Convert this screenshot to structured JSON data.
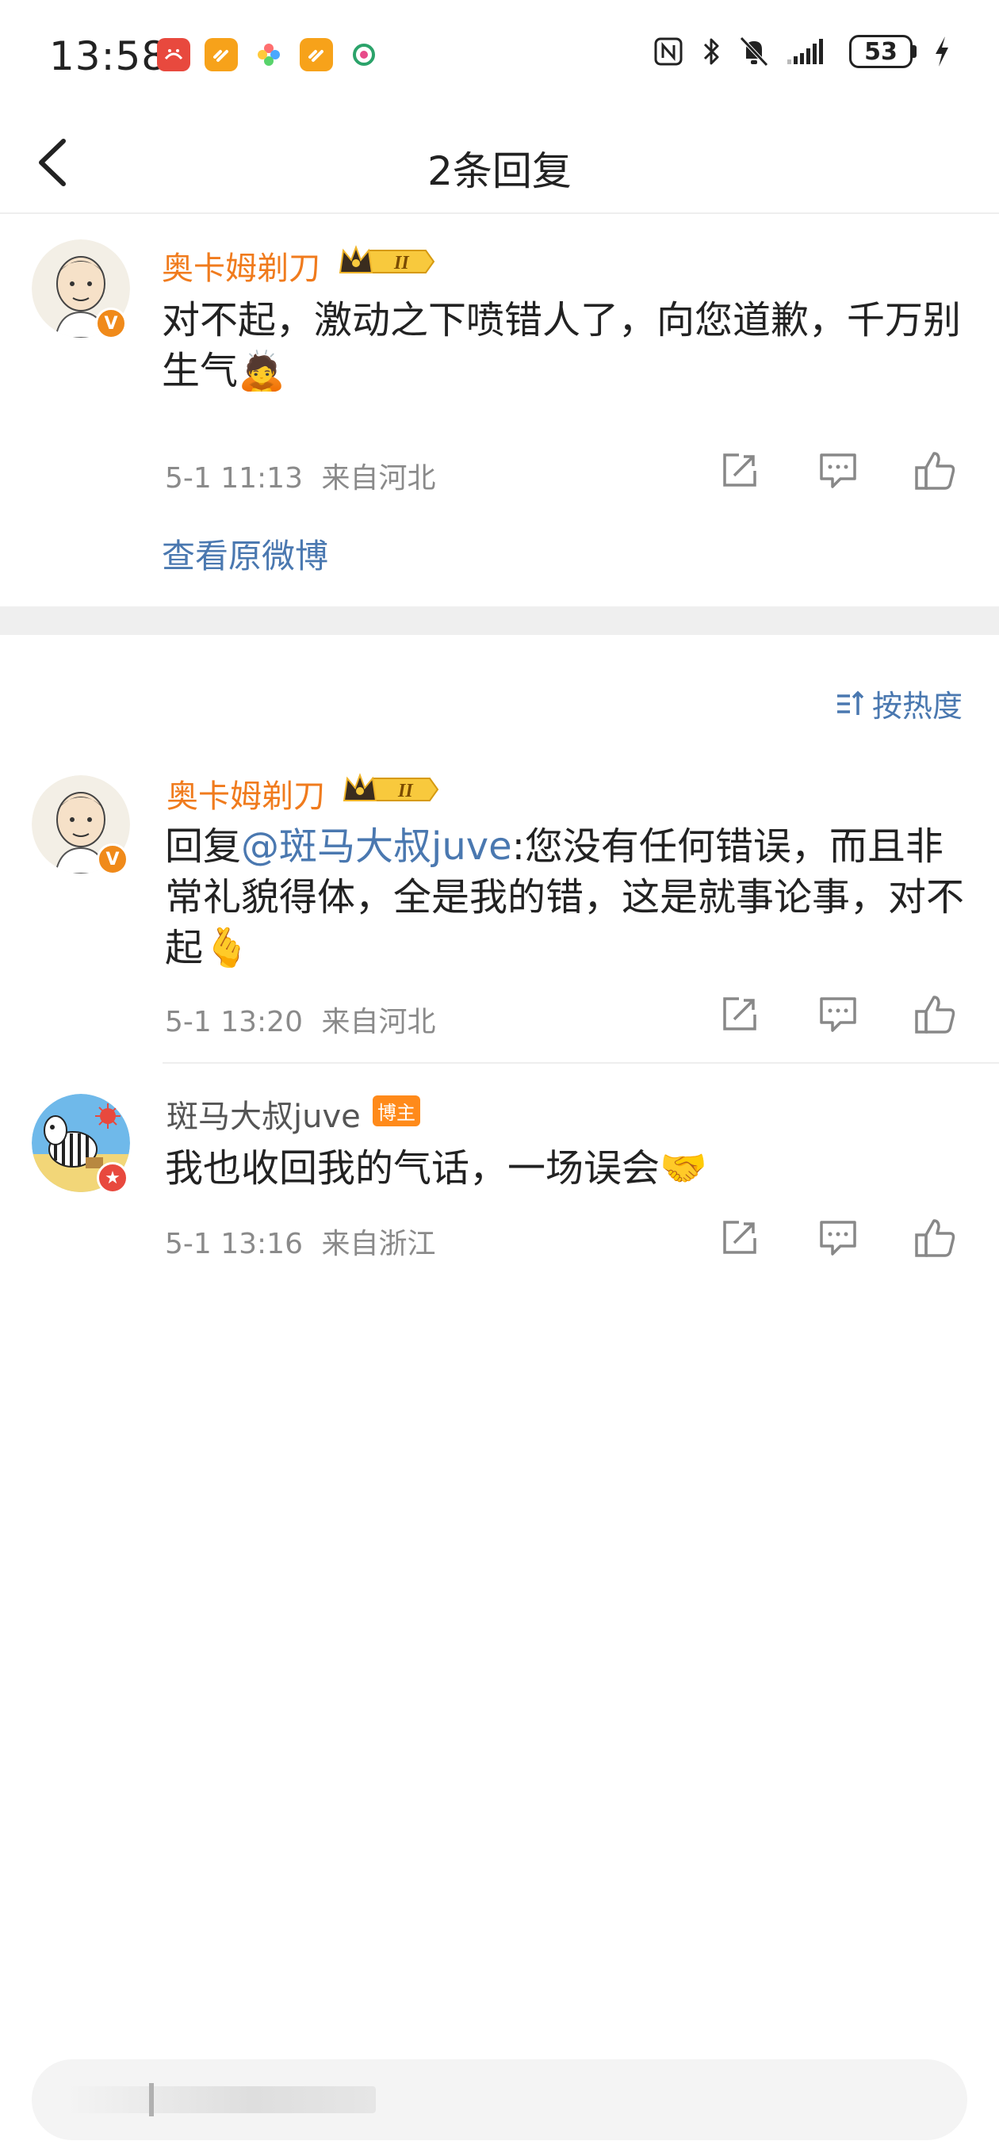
{
  "status_bar": {
    "time": "13:58",
    "battery": "53",
    "notification_icons": [
      "app-red-icon",
      "app-orange-icon",
      "app-flower-icon",
      "app-orange-icon-2",
      "app-green-icon"
    ],
    "system_icons": [
      "nfc-icon",
      "bluetooth-icon",
      "mute-icon",
      "signal-icon",
      "battery-icon",
      "charging-icon"
    ]
  },
  "header": {
    "title": "2条回复",
    "back_icon": "chevron-left-icon"
  },
  "root_comment": {
    "username": "奥卡姆剃刀",
    "vip_level": "II",
    "content": "对不起，激动之下喷错人了，向您道歉，千万别生气🙇",
    "time": "5-1 11:13",
    "location": "来自河北",
    "view_original": "查看原微博"
  },
  "sort": {
    "label": "按热度",
    "icon": "sort-icon"
  },
  "replies": [
    {
      "username": "奥卡姆剃刀",
      "vip_level": "II",
      "reply_prefix": "回复",
      "mention": "@斑马大叔juve",
      "content": ":您没有任何错误，而且非常礼貌得体，全是我的错，这是就事论事，对不起🫰",
      "time": "5-1 13:20",
      "location": "来自河北"
    },
    {
      "username": "斑马大叔juve",
      "badge": "博主",
      "content": "我也收回我的气话，一场误会🤝",
      "time": "5-1 13:16",
      "location": "来自浙江"
    }
  ],
  "colors": {
    "username_orange": "#f07b1d",
    "link_blue": "#4a78b0",
    "meta_grey": "#8a8a8a",
    "badge_orange": "#ff8a1a"
  }
}
